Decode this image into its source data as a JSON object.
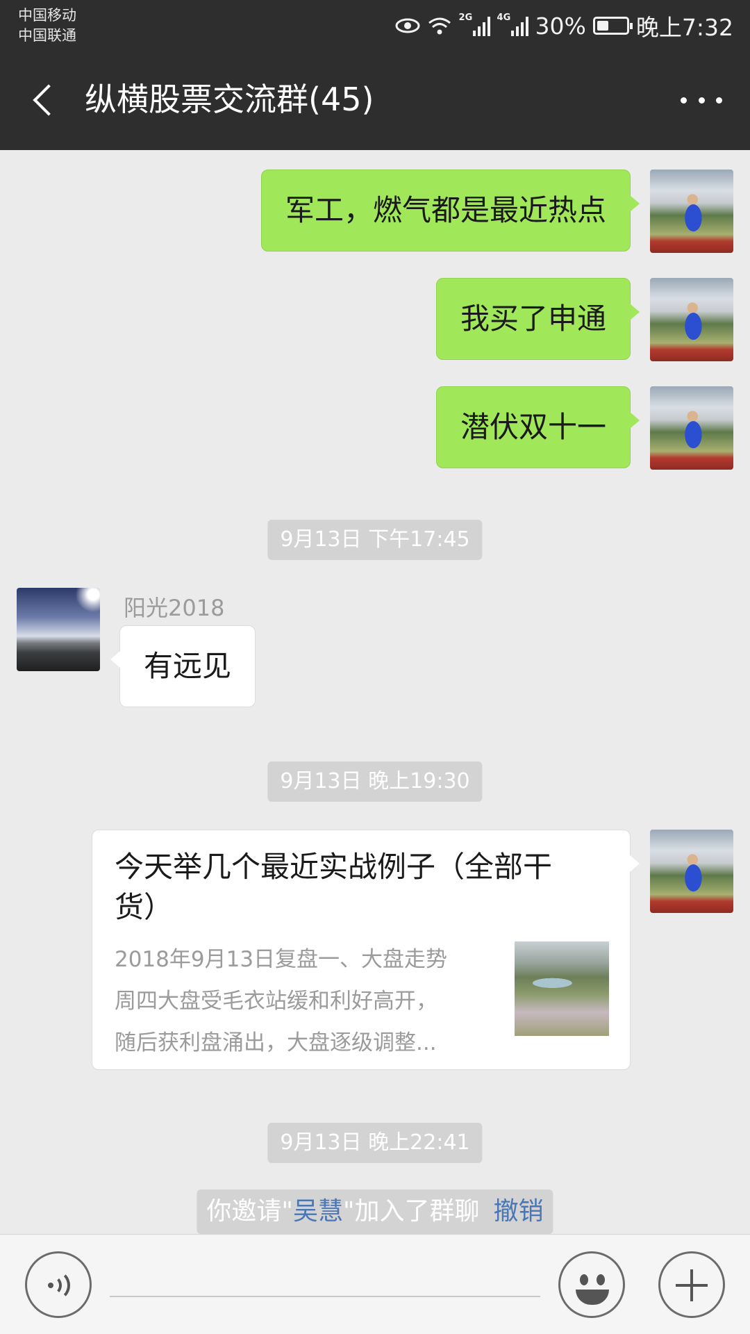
{
  "status_bar": {
    "carrier_1": "中国移动",
    "carrier_2": "中国联通",
    "signal_1_tag": "2G",
    "signal_2_tag": "4G",
    "battery": "30%",
    "time": "晚上7:32"
  },
  "header": {
    "title": "纵横股票交流群(45)"
  },
  "messages": [
    {
      "type": "outgoing",
      "text": "军工，燃气都是最近热点"
    },
    {
      "type": "outgoing",
      "text": "我买了申通"
    },
    {
      "type": "outgoing",
      "text": "潜伏双十一"
    },
    {
      "type": "timestamp",
      "text": "9月13日 下午17:45"
    },
    {
      "type": "incoming",
      "sender": "阳光2018",
      "text": "有远见"
    },
    {
      "type": "timestamp",
      "text": "9月13日 晚上19:30"
    },
    {
      "type": "outgoing_card",
      "title": "今天举几个最近实战例子（全部干货）",
      "desc_lines": [
        "2018年9月13日复盘一、大盘走势",
        "周四大盘受毛衣站缓和利好高开，",
        "随后获利盘涌出，大盘逐级调整..."
      ]
    },
    {
      "type": "timestamp",
      "text": "9月13日 晚上22:41"
    },
    {
      "type": "system",
      "prefix": "你邀请\"",
      "name": "吴慧",
      "suffix": "\"加入了群聊",
      "action": "撤销"
    }
  ],
  "colors": {
    "header_bg": "#2e2e2e",
    "chat_bg": "#ebebeb",
    "outgoing_bubble": "#a0e75a",
    "incoming_bubble": "#ffffff",
    "link": "#4a76b5"
  },
  "icons": {
    "back": "back-arrow-icon",
    "more": "more-dots-icon",
    "voice": "voice-icon",
    "emoji": "emoji-icon",
    "plus": "plus-icon"
  }
}
